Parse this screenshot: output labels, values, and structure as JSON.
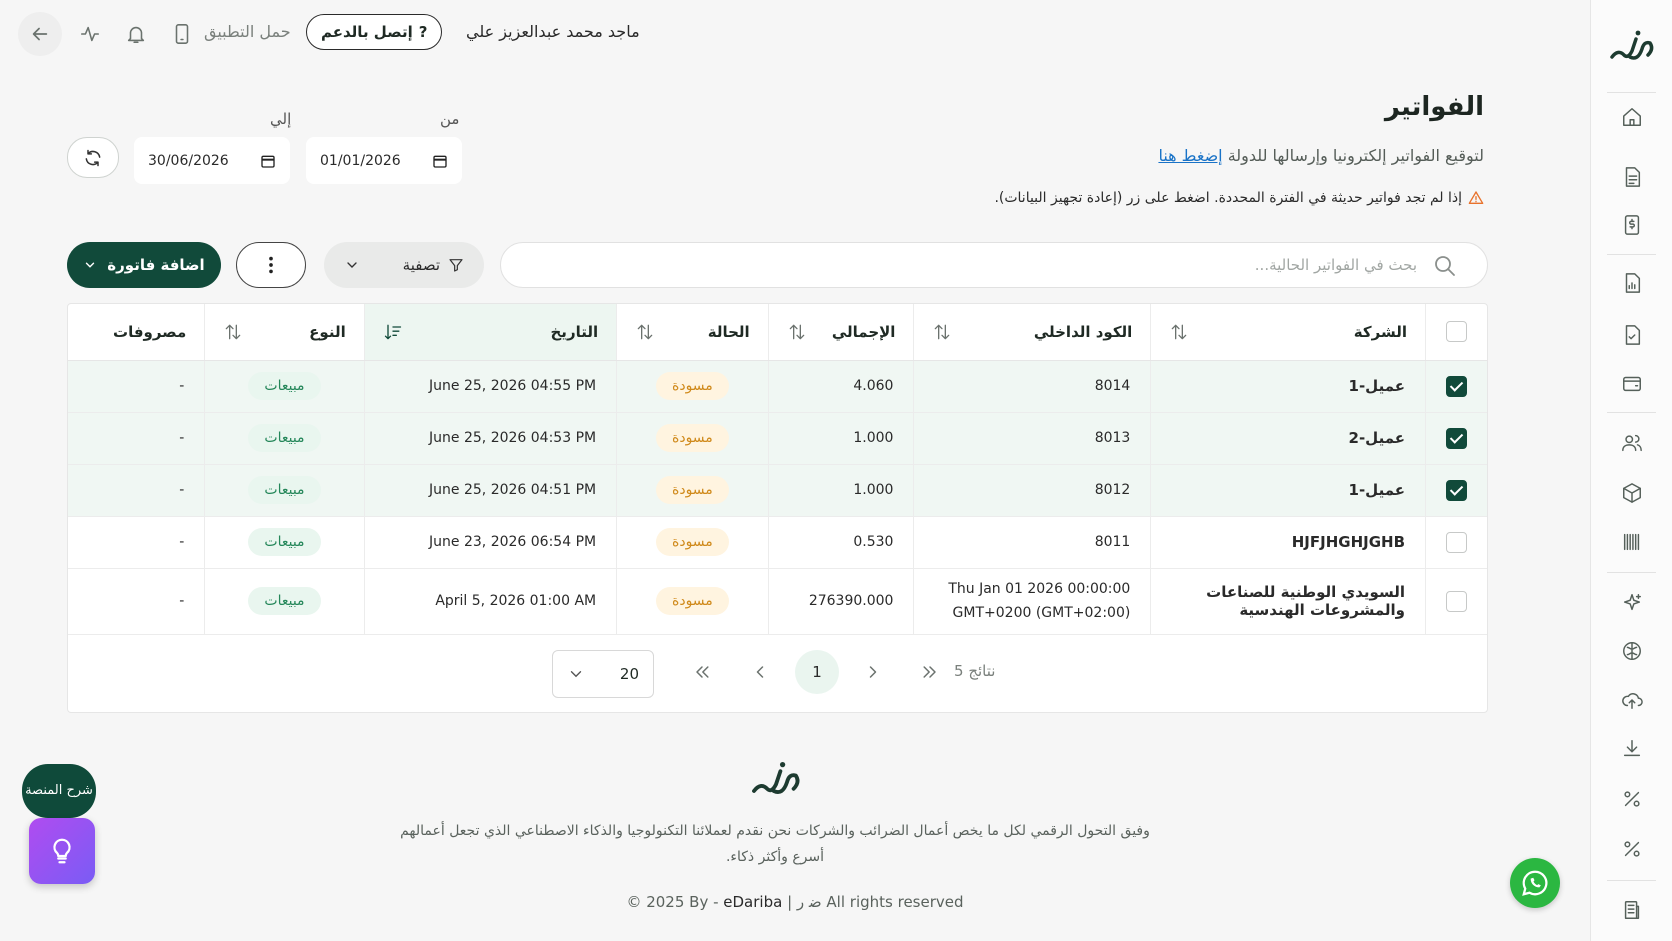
{
  "topbar": {
    "user_name": "ماجد محمد عبدالعزيز علي",
    "support_label": "إتصل بالدعم",
    "support_icon": "?",
    "download_app": "حمل التطبيق"
  },
  "header": {
    "title": "الفواتير",
    "subtitle": "لتوقيع الفواتير إلكترونيا وإرسالها للدولة",
    "subtitle_link": "إضغط هنا",
    "warning": "إذا لم تجد فواتير حديثة في الفترة المحددة. اضغط على زر (إعادة تجهيز البيانات)."
  },
  "date_range": {
    "from_label": "من",
    "from_value": "01/01/2026",
    "to_label": "إلي",
    "to_value": "30/06/2026"
  },
  "toolbar": {
    "search_placeholder": "بحث في الفواتير الحالية...",
    "filter_label": "تصفية",
    "add_label": "اضافة فاتورة"
  },
  "table": {
    "columns": [
      "الشركة",
      "الكود الداخلي",
      "الإجمالي",
      "الحالة",
      "التاريخ",
      "النوع",
      "مصروفات"
    ],
    "rows": [
      {
        "checked": true,
        "company": "عميل-1",
        "code": "8014",
        "total": "4.060",
        "status": "مسودة",
        "date": "June 25, 2026 04:55 PM",
        "type": "مبيعات",
        "expenses": "-"
      },
      {
        "checked": true,
        "company": "عميل-2",
        "code": "8013",
        "total": "1.000",
        "status": "مسودة",
        "date": "June 25, 2026 04:53 PM",
        "type": "مبيعات",
        "expenses": "-"
      },
      {
        "checked": true,
        "company": "عميل-1",
        "code": "8012",
        "total": "1.000",
        "status": "مسودة",
        "date": "June 25, 2026 04:51 PM",
        "type": "مبيعات",
        "expenses": "-"
      },
      {
        "checked": false,
        "company": "HJFJHGHJGHB",
        "code": "8011",
        "total": "0.530",
        "status": "مسودة",
        "date": "June 23, 2026 06:54 PM",
        "type": "مبيعات",
        "expenses": "-"
      },
      {
        "checked": false,
        "company_line1": "السويدي الوطنية للصناعات",
        "company_line2": "والمشروعات الهندسية",
        "code_line1": "Thu Jan 01 2026 00:00:00",
        "code_line2": "GMT+0200 (GMT+02:00)",
        "total": "276390.000",
        "status": "مسودة",
        "date": "April 5, 2026 01:00 AM",
        "type": "مبيعات",
        "expenses": "-"
      }
    ]
  },
  "pagination": {
    "page_size": "20",
    "current_page": "1",
    "results": "5 نتائج"
  },
  "footer": {
    "tagline": "وفيق التحول الرقمي لكل ما يخص أعمال الضرائب والشركات نحن نقدم لعملائنا التكنولوجيا والذكاء الاصطناعي الذي تجعل أعمالهم أسرع وأكثر ذكاء.",
    "copyright_prefix": "© 2025 By - ",
    "brand": "eDariba",
    "copyright_mid": " | ",
    "copyright_glyph": "ﺿ ﺭ",
    "copyright_suffix": "  All rights reserved"
  },
  "floating": {
    "tour_label": "شرح المنصة"
  },
  "colors": {
    "brand_green": "#114a3a",
    "draft_orange": "#d08a1b",
    "sales_green": "#25875a",
    "link_blue": "#1a73c7"
  },
  "icons": {
    "sidebar": [
      "home-icon",
      "document-icon",
      "dollar-document-icon",
      "chart-document-icon",
      "check-document-icon",
      "wallet-icon",
      "users-icon",
      "box-icon",
      "barcode-icon",
      "sparkle-icon",
      "brain-icon",
      "cloud-upload-icon",
      "download-icon",
      "percent-icon",
      "percent-alt-icon",
      "building-document-icon"
    ]
  }
}
